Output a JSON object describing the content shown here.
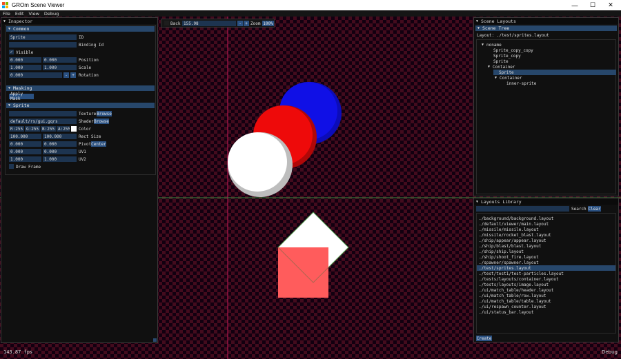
{
  "window": {
    "title": "GROm Scene Viewer",
    "minimize": "—",
    "maximize": "☐",
    "close": "✕",
    "logo_colors": [
      "#f25022",
      "#7fba00",
      "#00a4ef",
      "#ffb900"
    ]
  },
  "menu": [
    "File",
    "Edit",
    "View",
    "Debug"
  ],
  "toolbar": {
    "back_label": "Back",
    "zoom_value": "155.98",
    "minus": "-",
    "plus": "+",
    "zoom_label": "Zoom",
    "reset_label": "100%"
  },
  "inspector": {
    "title": "Inspector",
    "common": {
      "header": "Common",
      "id_value": "Sprite",
      "id_label": "ID",
      "binding_value": "",
      "binding_label": "Binding Id",
      "visible_label": "Visible",
      "visible_checked": true,
      "position": [
        "0.000",
        "0.000"
      ],
      "position_label": "Position",
      "scale": [
        "1.000",
        "1.000"
      ],
      "scale_label": "Scale",
      "rotation": "0.000",
      "rotation_label": "Rotation",
      "minus": "-",
      "plus": "+"
    },
    "masking": {
      "header": "Masking",
      "apply_mask": "Apply Mask"
    },
    "sprite": {
      "header": "Sprite",
      "texture_value": "",
      "texture_label": "Texture",
      "browse": "Browse",
      "shader_value": "default/rs/gui.gqrs",
      "shader_label": "Shader",
      "color": [
        "R:255",
        "G:255",
        "B:255",
        "A:255"
      ],
      "color_label": "Color",
      "swatch": "#ffffff",
      "rect_size": [
        "100.000",
        "100.000"
      ],
      "rect_size_label": "Rect Size",
      "pivot": [
        "0.000",
        "0.000"
      ],
      "pivot_label": "Pivot",
      "center": "Center",
      "uv1": [
        "0.000",
        "0.000"
      ],
      "uv1_label": "UV1",
      "uv2": [
        "1.000",
        "1.000"
      ],
      "uv2_label": "UV2",
      "draw_frame_label": "Draw Frame"
    }
  },
  "scene_layouts": {
    "title": "Scene Layouts",
    "tree_header": "Scene Tree",
    "layout_path": "Layout: ./test/sprites.layout",
    "tree": [
      {
        "label": "noname",
        "depth": 0,
        "expanded": true
      },
      {
        "label": "Sprite_copy_copy",
        "depth": 1
      },
      {
        "label": "Sprite_copy",
        "depth": 1
      },
      {
        "label": "Sprite",
        "depth": 1
      },
      {
        "label": "Container",
        "depth": 1,
        "expanded": true
      },
      {
        "label": "Sprite",
        "depth": 2,
        "selected": true
      },
      {
        "label": "Container",
        "depth": 2,
        "expanded": true
      },
      {
        "label": "inner-sprite",
        "depth": 3
      }
    ]
  },
  "layouts_library": {
    "title": "Layouts Library",
    "search_value": "",
    "search_label": "Search",
    "clear_label": "Clear",
    "items": [
      "./background/background.layout",
      "./default/viewer/main.layout",
      "./missile/missile.layout",
      "./missile/rocket_blast.layout",
      "./ship/appear/appear.layout",
      "./ship/blast/blast.layout",
      "./ship/ship.layout",
      "./ship/shoot_fire.layout",
      "./spawner/spawner.layout",
      "./test/sprites.layout",
      "./test/test1/test-particles.layout",
      "./tests/layouts/container.layout",
      "./tests/layouts/image.layout",
      "./ui/match_table/header.layout",
      "./ui/match_table/row.layout",
      "./ui/match_table/table.layout",
      "./ui/respawn_counter.layout",
      "./ui/status_bar.layout"
    ],
    "selected_index": 9,
    "create_label": "Create"
  },
  "status": {
    "fps": "143.87 fps",
    "mode": "Debug"
  },
  "colors": {
    "blue_ball": "#1010e6",
    "red_ball": "#ee0a0a",
    "white_ball": "#ffffff",
    "pink_square": "#ff5c5c",
    "guide_red": "#c4185a",
    "guide_green": "#3f8a3f"
  }
}
